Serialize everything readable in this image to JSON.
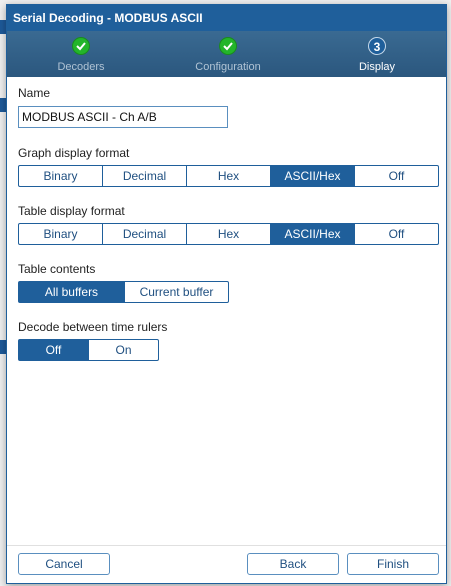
{
  "window": {
    "title": "Serial Decoding - MODBUS ASCII"
  },
  "steps": [
    {
      "label": "Decoders",
      "status": "done"
    },
    {
      "label": "Configuration",
      "status": "done"
    },
    {
      "label": "Display",
      "status": "current",
      "number": "3"
    }
  ],
  "name": {
    "label": "Name",
    "value": "MODBUS ASCII - Ch A/B"
  },
  "graph_format": {
    "label": "Graph display format",
    "options": [
      "Binary",
      "Decimal",
      "Hex",
      "ASCII/Hex",
      "Off"
    ],
    "selected": "ASCII/Hex"
  },
  "table_format": {
    "label": "Table display format",
    "options": [
      "Binary",
      "Decimal",
      "Hex",
      "ASCII/Hex",
      "Off"
    ],
    "selected": "ASCII/Hex"
  },
  "table_contents": {
    "label": "Table contents",
    "options": [
      "All buffers",
      "Current buffer"
    ],
    "selected": "All buffers"
  },
  "decode_between": {
    "label": "Decode between time rulers",
    "options": [
      "Off",
      "On"
    ],
    "selected": "Off"
  },
  "buttons": {
    "cancel": "Cancel",
    "back": "Back",
    "finish": "Finish"
  },
  "colors": {
    "accent": "#1f5f9b",
    "done": "#23b52a"
  }
}
